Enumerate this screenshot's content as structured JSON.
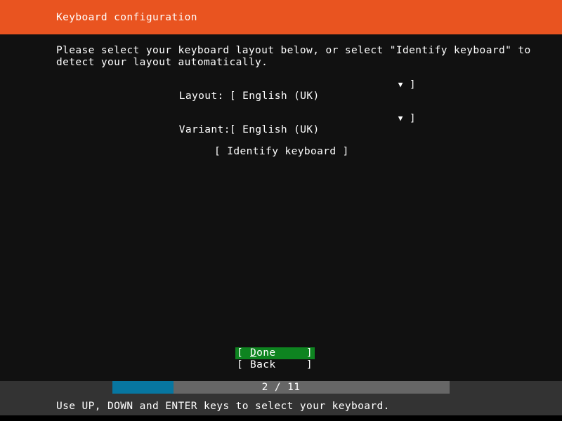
{
  "header": {
    "title": "Keyboard configuration",
    "background_color": "#e95420",
    "text_color": "#ffffff"
  },
  "body": {
    "background_color": "#111111",
    "intro_line_1": "Please select your keyboard layout below, or select \"Identify keyboard\" to",
    "intro_line_2": "detect your layout automatically.",
    "fields": [
      {
        "label": "Layout:",
        "open_bracket": "[",
        "value": "English (UK)",
        "caret_icon": "▼",
        "close_bracket": "]"
      },
      {
        "label": "Variant:",
        "open_bracket": "[",
        "value": "English (UK)",
        "caret_icon": "▼",
        "close_bracket": "]"
      }
    ],
    "identify_button": {
      "open_bracket": "[",
      "label": "Identify keyboard",
      "close_bracket": "]"
    }
  },
  "actions": {
    "selected_color": "#0e8420",
    "buttons": [
      {
        "open_bracket": "[",
        "mnemonic": "D",
        "label_rest": "one",
        "close_bracket": "]",
        "selected": true
      },
      {
        "open_bracket": "[",
        "mnemonic": "",
        "label_rest": "Back",
        "close_bracket": "]",
        "selected": false
      }
    ]
  },
  "footer": {
    "background_color": "#333333",
    "progress": {
      "text": "2 / 11",
      "current": 2,
      "total": 11,
      "fill_color": "#0776a0",
      "track_color": "#666666"
    },
    "hint": "Use UP, DOWN and ENTER keys to select your keyboard."
  }
}
